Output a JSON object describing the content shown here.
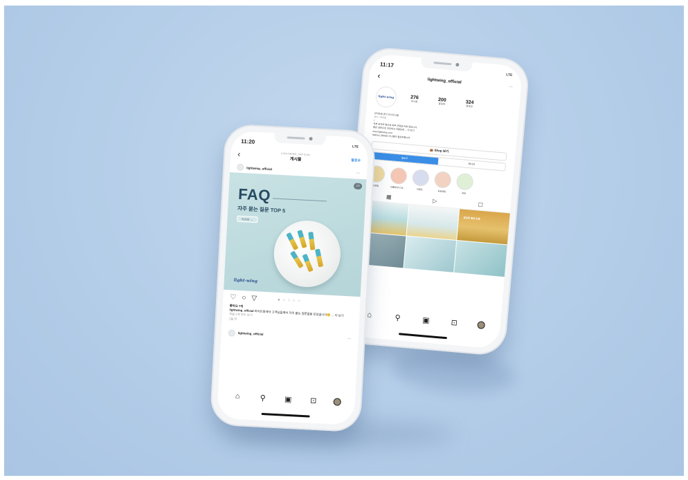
{
  "front_phone": {
    "status": {
      "time": "11:20",
      "signal": "LTE"
    },
    "nav": {
      "subtitle": "LIGHTWING_OFFICIAL",
      "title": "게시물",
      "follow": "팔로우"
    },
    "post": {
      "username": "lightwing_official",
      "more": "···",
      "image": {
        "counter": "1/5",
        "headline": "FAQ",
        "subheadline": "자주 묻는 질문 TOP 5",
        "slide_button": "SLIDE →",
        "brand": "light-wing"
      },
      "pager": "● ○ ○ ○ ○",
      "likes": "좋아요 7개",
      "caption_user": "lightwing_official",
      "caption_text": "라이트윙에서 고객님들께서 자주 묻는 질문들을 모았습니다🙂 ... 더 보기",
      "comments_link": "댓글 2개 모두 보기",
      "date": "1일 전"
    },
    "next_post": {
      "username": "lightwing_official",
      "more": "···"
    },
    "tabbar": [
      "home-icon",
      "search-icon",
      "reels-icon",
      "shop-icon",
      "profile-avatar"
    ]
  },
  "back_phone": {
    "status": {
      "time": "11:17",
      "signal": "LTE"
    },
    "profile": {
      "username": "lightwing_official",
      "more": "···",
      "avatar_text": "light-wing",
      "stats": [
        {
          "value": "276",
          "label": "게시물"
        },
        {
          "value": "200",
          "label": "팔로워"
        },
        {
          "value": "324",
          "label": "팔로잉"
        }
      ],
      "bio": [
        "라이트윙 공식 인스타그램",
        "뷰티 / 화장품",
        "•",
        "피부 본연의 힘으로 피부 균형을 바로 잡습니다.",
        "좋은 성분으로 건강하고 아름답게 ... 더 보기",
        "www.lightwing.co.kr",
        "fashion_0000님 외 2명이 팔로우합니다"
      ],
      "shop_button": "👜 Shop 보기",
      "segments": [
        "팔로우",
        "메시지"
      ],
      "highlights": [
        "프로필",
        "인플루언서 후...",
        "이벤트",
        "무료체험",
        "리뷰"
      ],
      "highlight_colors": [
        "#f3dca0",
        "#f4c6b4",
        "#d8dcef",
        "#f2d2c1",
        "#dff0d6"
      ],
      "grid_tabs": [
        "grid-icon",
        "reels-icon",
        "tagged-icon"
      ],
      "grid_overlay_text": "궁금한 질문 모음"
    },
    "tabbar": [
      "home-icon",
      "search-icon",
      "reels-icon",
      "shop-icon",
      "profile-avatar"
    ]
  }
}
